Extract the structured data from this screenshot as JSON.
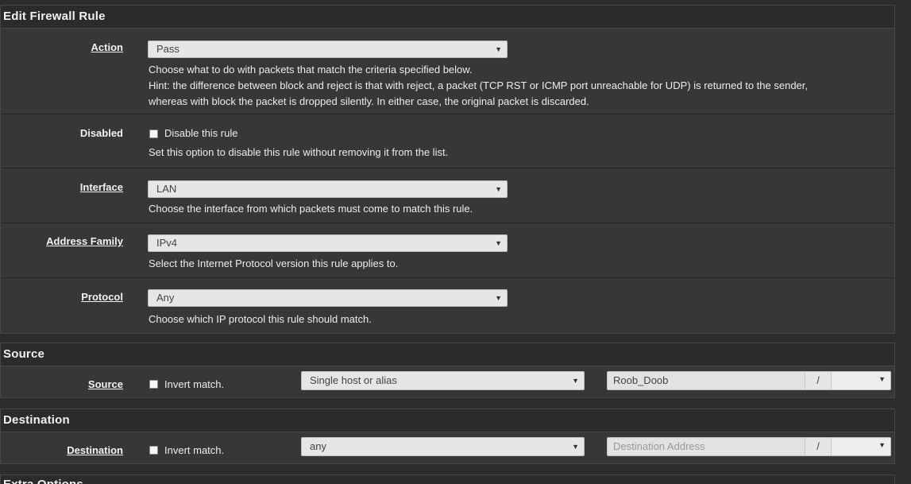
{
  "edit_rule": {
    "title": "Edit Firewall Rule",
    "action": {
      "label": "Action",
      "value": "Pass",
      "help1": "Choose what to do with packets that match the criteria specified below.",
      "help2": "Hint: the difference between block and reject is that with reject, a packet (TCP RST or ICMP port unreachable for UDP) is returned to the sender,",
      "help3": "whereas with block the packet is dropped silently. In either case, the original packet is discarded."
    },
    "disabled": {
      "label": "Disabled",
      "checkbox_label": "Disable this rule",
      "checked": false,
      "help": "Set this option to disable this rule without removing it from the list."
    },
    "interface": {
      "label": "Interface",
      "value": "LAN",
      "help": "Choose the interface from which packets must come to match this rule."
    },
    "address_family": {
      "label": "Address Family",
      "value": "IPv4",
      "help": "Select the Internet Protocol version this rule applies to."
    },
    "protocol": {
      "label": "Protocol",
      "value": "Any",
      "help": "Choose which IP protocol this rule should match."
    }
  },
  "source": {
    "title": "Source",
    "label": "Source",
    "invert_label": "Invert match.",
    "type": "Single host or alias",
    "address": "Roob_Doob",
    "slash": "/"
  },
  "destination": {
    "title": "Destination",
    "label": "Destination",
    "invert_label": "Invert match.",
    "type": "any",
    "address_placeholder": "Destination Address",
    "slash": "/"
  },
  "extra_options": {
    "title": "Extra Options"
  },
  "icons": {
    "caret": "caret-down-icon"
  }
}
